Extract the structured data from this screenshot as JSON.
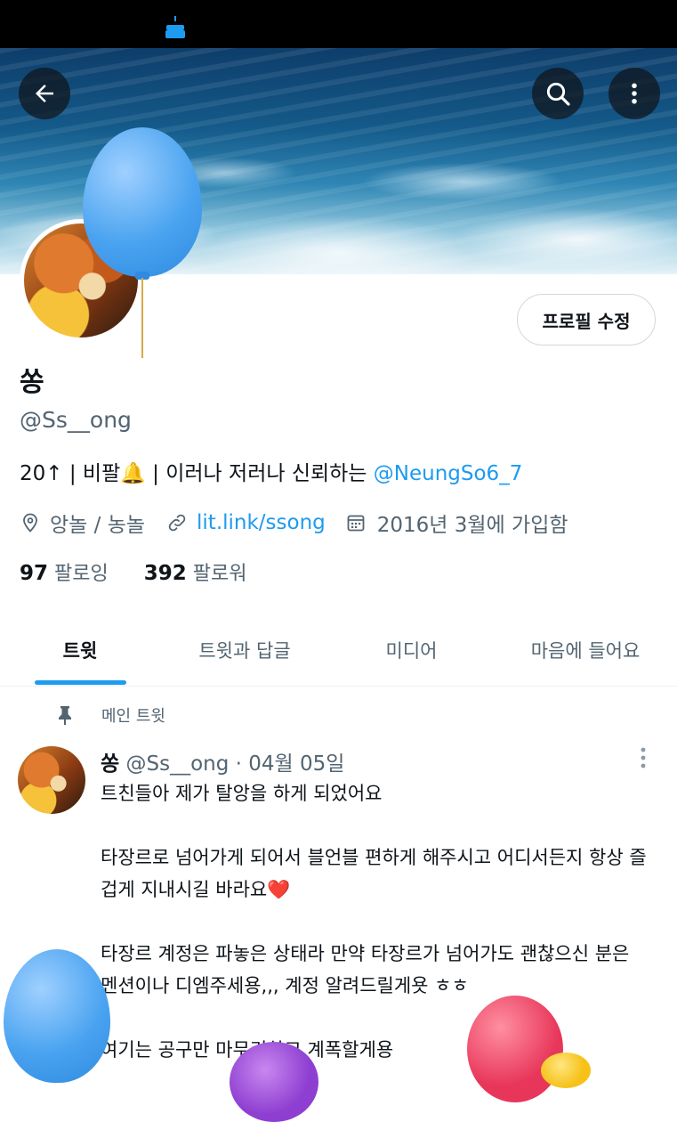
{
  "profile": {
    "display_name": "쏭",
    "handle": "@Ss__ong",
    "edit_profile_label": "프로필 수정",
    "bio_text": "20↑ | 비팔🔔 | 이러나 저러나 신뢰하는 ",
    "bio_mention": "@NeungSo6_7",
    "location": "앙놀 / 농놀",
    "website": "lit.link/ssong",
    "joined": "2016년 3월에 가입함",
    "following_count": "97",
    "following_label": "팔로잉",
    "followers_count": "392",
    "followers_label": "팔로워"
  },
  "tabs": [
    {
      "label": "트윗",
      "active": true
    },
    {
      "label": "트윗과 답글",
      "active": false
    },
    {
      "label": "미디어",
      "active": false
    },
    {
      "label": "마음에 들어요",
      "active": false
    }
  ],
  "pinned_tweet": {
    "pin_label": "메인 트윗",
    "author_name": "쏭",
    "author_handle": "@Ss__ong",
    "separator": "·",
    "date": "04월 05일",
    "paragraphs": [
      "트친들아 제가 탈앙을 하게 되었어요",
      "타장르로 넘어가게 되어서 블언블 편하게 해주시고 어디서든지 항상 즐겁게 지내시길 바라요❤️",
      "타장르 계정은 파놓은 상태라 만약 타장르가 넘어가도 괜찮으신 분은 멘션이나 디엠주세용,,, 계정 알려드릴게욧 ㅎㅎ",
      "여기는 공구만 마무리하고 계폭할게용"
    ]
  },
  "icons": {
    "back": "arrow-left-icon",
    "search": "search-icon",
    "more": "more-vertical-icon",
    "birthday": "cake-icon",
    "location": "location-pin-icon",
    "link": "link-icon",
    "calendar": "calendar-icon",
    "pin": "pin-icon"
  },
  "colors": {
    "accent": "#1d9bf0",
    "text_primary": "#0f1419",
    "text_secondary": "#536471"
  }
}
